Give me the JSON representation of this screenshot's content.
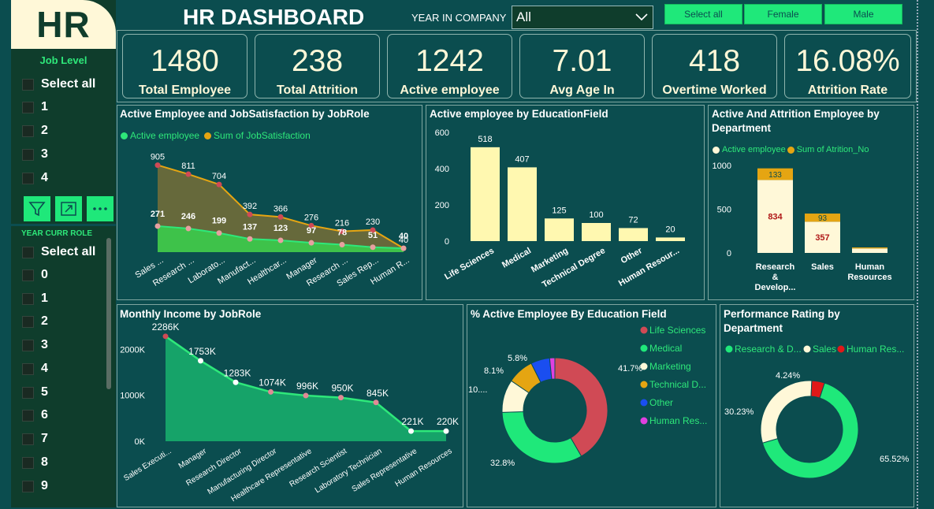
{
  "header": {
    "logo": "HR",
    "title": "HR DASHBOARD",
    "year_label": "YEAR IN COMPANY",
    "year_value": "All",
    "buttons": [
      "Select all",
      "Female",
      "Male"
    ]
  },
  "sidebar": {
    "job_level_title": "Job Level",
    "job_level_items": [
      "Select all",
      "1",
      "2",
      "3",
      "4"
    ],
    "year_role_title": "YEAR CURR ROLE",
    "year_role_items": [
      "Select all",
      "0",
      "1",
      "2",
      "3",
      "4",
      "5",
      "6",
      "7",
      "8",
      "9"
    ]
  },
  "kpis": [
    {
      "value": "1480",
      "label": "Total Employee"
    },
    {
      "value": "238",
      "label": "Total Attrition"
    },
    {
      "value": "1242",
      "label": "Active employee"
    },
    {
      "value": "7.01",
      "label": "Avg Age In"
    },
    {
      "value": "418",
      "label": "Overtime Worked"
    },
    {
      "value": "16.08%",
      "label": "Attrition Rate"
    }
  ],
  "colors": {
    "bg": "#0b4d4f",
    "green": "#2ee87a",
    "gold": "#e5a512",
    "cream": "#fff8b0",
    "red": "#d04a55"
  },
  "chart_data": [
    {
      "id": "jobrole_satisfaction",
      "type": "area",
      "title": "Active Employee and JobSatisfaction by JobRole",
      "categories": [
        "Sales ...",
        "Research ...",
        "Laborato...",
        "Manufact...",
        "Healthcar...",
        "Manager",
        "Research ...",
        "Sales Rep...",
        "Human R..."
      ],
      "series": [
        {
          "name": "Active employee",
          "values": [
            271,
            246,
            199,
            137,
            123,
            97,
            78,
            51,
            40
          ]
        },
        {
          "name": "Sum of JobSatisfaction",
          "values": [
            905,
            811,
            704,
            392,
            366,
            276,
            216,
            230,
            40
          ]
        }
      ],
      "ylim": [
        0,
        1000
      ]
    },
    {
      "id": "education_field",
      "type": "bar",
      "title": "Active employee by EducationField",
      "categories": [
        "Life Sciences",
        "Medical",
        "Marketing",
        "Technical Degree",
        "Other",
        "Human Resour..."
      ],
      "values": [
        518,
        407,
        125,
        100,
        72,
        20
      ],
      "yticks": [
        "0",
        "200",
        "400",
        "600"
      ],
      "ylim": [
        0,
        600
      ]
    },
    {
      "id": "department_attrition",
      "type": "bar",
      "title": "Active And Attrition Employee by Department",
      "categories": [
        "Research & Develop...",
        "Sales",
        "Human Resources"
      ],
      "series": [
        {
          "name": "Active employee",
          "values": [
            834,
            357,
            51
          ]
        },
        {
          "name": "Sum of Atrition_No",
          "values": [
            133,
            93,
            12
          ]
        }
      ],
      "yticks": [
        "0",
        "500",
        "1000"
      ],
      "ylim": [
        0,
        1000
      ]
    },
    {
      "id": "monthly_income",
      "type": "area",
      "title": "Monthly Income by JobRole",
      "categories": [
        "Sales Executi...",
        "Manager",
        "Research Director",
        "Manufacturing Director",
        "Healthcare Representative",
        "Research Scientist",
        "Laboratory Technician",
        "Sales Representative",
        "Human Resources"
      ],
      "values": [
        2286,
        1753,
        1283,
        1074,
        996,
        950,
        845,
        221,
        220
      ],
      "labels": [
        "2286K",
        "1753K",
        "1283K",
        "1074K",
        "996K",
        "950K",
        "845K",
        "221K",
        "220K"
      ],
      "yticks": [
        "0K",
        "1000K",
        "2000K"
      ],
      "ylim": [
        0,
        2300
      ]
    },
    {
      "id": "education_pct",
      "type": "pie",
      "title": "% Active Employee By Education Field",
      "categories": [
        "Life Sciences",
        "Medical",
        "Marketing",
        "Technical D...",
        "Other",
        "Human Res..."
      ],
      "values": [
        41.7,
        32.8,
        10.1,
        8.1,
        5.8,
        1.6
      ],
      "labels": [
        "41.7%",
        "32.8%",
        "10....",
        "8.1%",
        "5.8%",
        ""
      ],
      "colors": [
        "#d04a55",
        "#1fe87a",
        "#fff8d8",
        "#e5a512",
        "#1a4ef0",
        "#e040e0"
      ]
    },
    {
      "id": "performance_rating",
      "type": "pie",
      "title": "Performance Rating by Department",
      "categories": [
        "Research & D...",
        "Sales",
        "Human Res..."
      ],
      "values": [
        65.52,
        30.23,
        4.24
      ],
      "labels": [
        "65.52%",
        "30.23%",
        "4.24%"
      ],
      "colors": [
        "#1fe87a",
        "#fff8d8",
        "#e01818"
      ]
    }
  ]
}
